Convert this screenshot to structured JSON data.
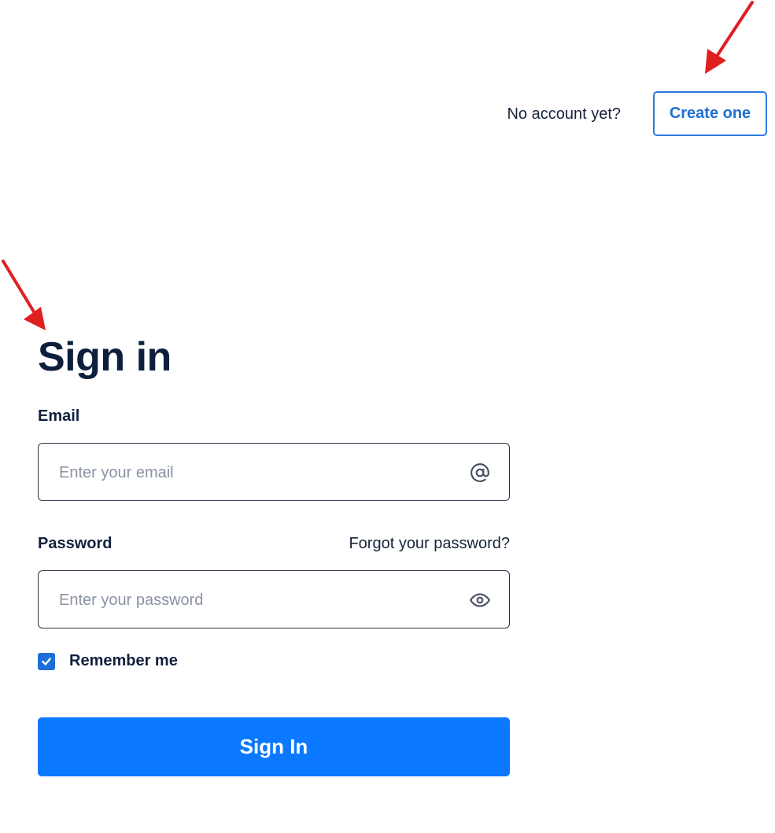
{
  "header": {
    "prompt_text": "No account yet?",
    "create_label": "Create one"
  },
  "form": {
    "title": "Sign in",
    "email": {
      "label": "Email",
      "placeholder": "Enter your email",
      "value": ""
    },
    "password": {
      "label": "Password",
      "placeholder": "Enter your password",
      "value": ""
    },
    "forgot_label": "Forgot your password?",
    "remember": {
      "label": "Remember me",
      "checked": true
    },
    "submit_label": "Sign In"
  },
  "icons": {
    "email": "at-sign-icon",
    "password": "eye-icon",
    "remember": "checkmark-icon"
  },
  "colors": {
    "primary": "#0a78ff",
    "outline_button": "#2c7be0",
    "heading": "#0d1f3c",
    "annotation_arrow": "#e02020"
  }
}
